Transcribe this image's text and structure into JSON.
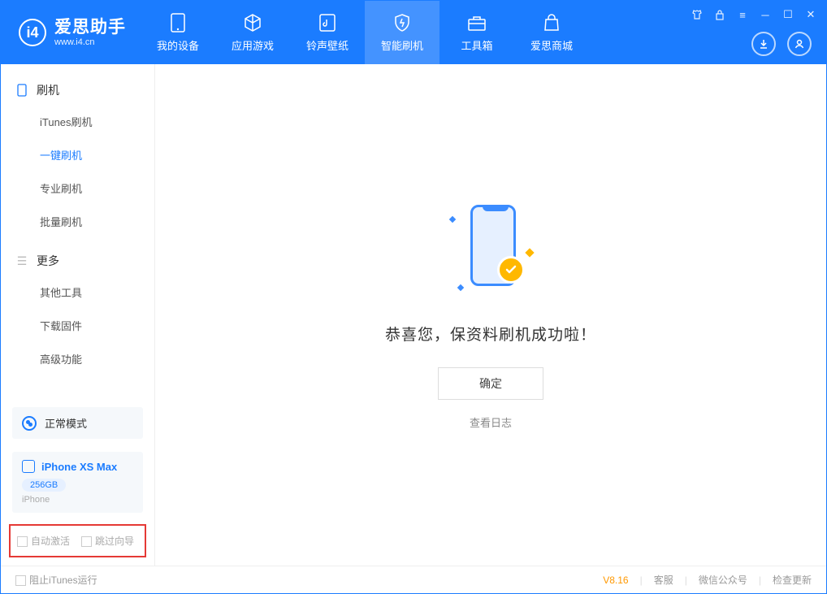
{
  "app": {
    "title": "爱思助手",
    "subtitle": "www.i4.cn"
  },
  "nav": {
    "items": [
      {
        "label": "我的设备"
      },
      {
        "label": "应用游戏"
      },
      {
        "label": "铃声壁纸"
      },
      {
        "label": "智能刷机"
      },
      {
        "label": "工具箱"
      },
      {
        "label": "爱思商城"
      }
    ],
    "activeIndex": 3
  },
  "sidebar": {
    "sections": [
      {
        "title": "刷机",
        "items": [
          "iTunes刷机",
          "一键刷机",
          "专业刷机",
          "批量刷机"
        ],
        "activeIndex": 1
      },
      {
        "title": "更多",
        "items": [
          "其他工具",
          "下载固件",
          "高级功能"
        ],
        "activeIndex": -1
      }
    ],
    "mode": "正常模式",
    "device": {
      "name": "iPhone XS Max",
      "capacity": "256GB",
      "type": "iPhone"
    },
    "options": {
      "autoActivate": "自动激活",
      "skipGuide": "跳过向导"
    }
  },
  "main": {
    "successMessage": "恭喜您，保资料刷机成功啦！",
    "okButton": "确定",
    "viewLog": "查看日志"
  },
  "footer": {
    "blockItunes": "阻止iTunes运行",
    "version": "V8.16",
    "links": [
      "客服",
      "微信公众号",
      "检查更新"
    ]
  }
}
